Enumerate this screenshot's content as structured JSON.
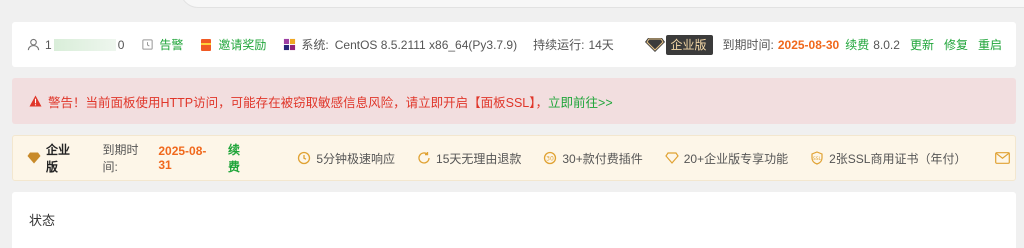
{
  "header": {
    "user_prefix": "1",
    "user_suffix": "0",
    "alarm_label": "告警",
    "invite_label": "邀请奖励",
    "system_label": "系统:",
    "system_value": "CentOS 8.5.2111 x86_64(Py3.7.9)",
    "uptime_label": "持续运行:",
    "uptime_value": "14天",
    "edition_badge": "企业版",
    "expire_label": "到期时间:",
    "expire_date": "2025-08-30",
    "renew_label": "续费",
    "version": "8.0.2",
    "update_label": "更新",
    "repair_label": "修复",
    "restart_label": "重启"
  },
  "warning": {
    "text": "警告！当前面板使用HTTP访问，可能存在被窃取敏感信息风险，请立即开启【面板SSL】，",
    "link": "立即前往>>"
  },
  "enterprise": {
    "title": "企业版",
    "expire_label": "到期时间:",
    "expire_date": "2025-08-31",
    "renew_label": "续费",
    "features": [
      "5分钟极速响应",
      "15天无理由退款",
      "30+款付费插件",
      "20+企业版专享功能",
      "2张SSL商用证书（年付）"
    ]
  },
  "status": {
    "title": "状态"
  },
  "colors": {
    "green": "#20a53a",
    "orange": "#f0681c",
    "warning_bg": "#f2dedf",
    "warning_text": "#e0362a",
    "enterprise_bg": "#fdf6e8"
  }
}
